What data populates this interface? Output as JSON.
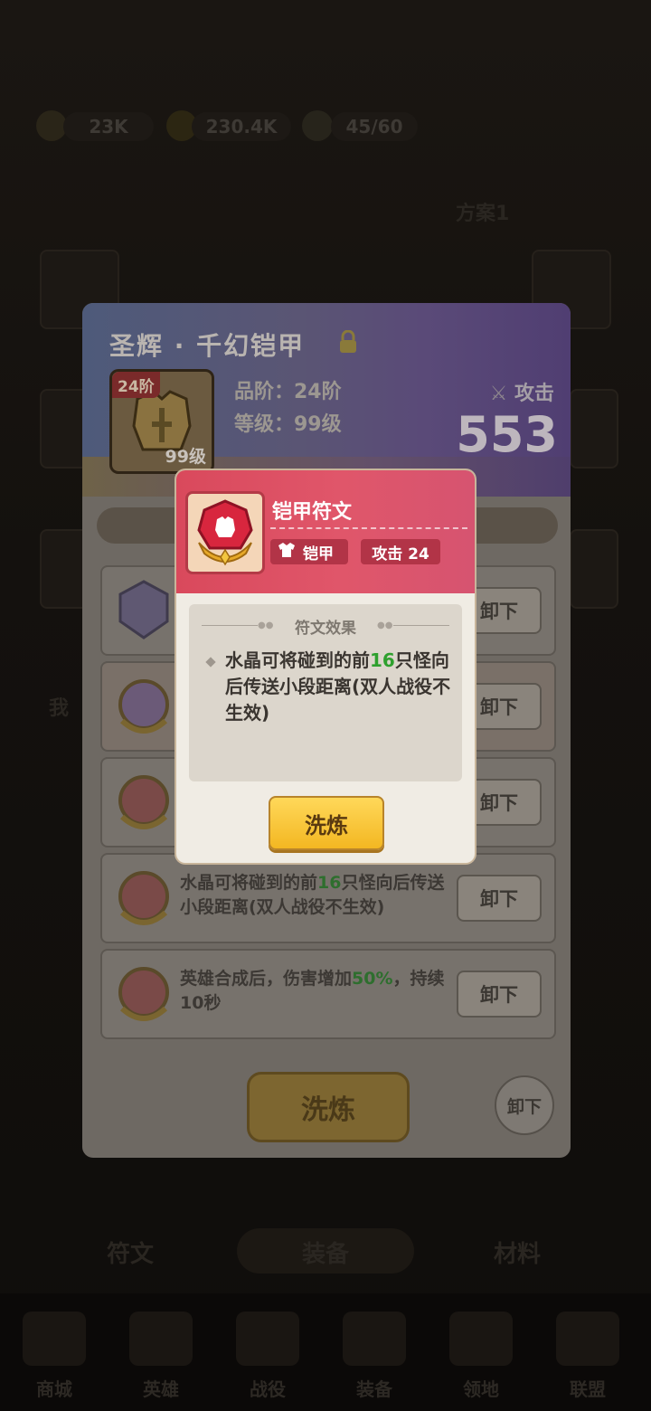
{
  "background": {
    "resources": [
      {
        "name": "gem",
        "value": "23K"
      },
      {
        "name": "gold",
        "value": "230.4K"
      },
      {
        "name": "stamina",
        "value": "45/60"
      }
    ],
    "scheme_label": "方案1",
    "side_label": "我",
    "bottom_tabs": [
      "符文",
      "装备",
      "材料"
    ],
    "nav": [
      "商城",
      "英雄",
      "战役",
      "装备",
      "领地",
      "联盟"
    ]
  },
  "equipment": {
    "title": "圣辉 · 千幻铠甲",
    "tier_badge": "24阶",
    "level_badge": "99级",
    "grade_line": "品阶：24阶",
    "level_line": "等级：99级",
    "attack_label": "攻击",
    "attack_value": "553",
    "rows": [
      {
        "text": "",
        "btn": "卸下"
      },
      {
        "text": "",
        "btn": "卸下"
      },
      {
        "text": "",
        "btn": "卸下"
      },
      {
        "text_a": "水晶可将碰到的前",
        "text_num": "16",
        "text_b": "只怪向后传送小段距离(双人战役不生效)",
        "btn": "卸下"
      },
      {
        "text_a": "英雄合成后，伤害增加",
        "text_num": "50%",
        "text_b": "，持续10秒",
        "btn": "卸下"
      }
    ],
    "wash_button": "洗炼",
    "unload_round": "卸下"
  },
  "dialog": {
    "title": "铠甲符文",
    "type_tag": "铠甲",
    "attack_tag": "攻击 24",
    "effect_header": "符文效果",
    "effect_a": "水晶可将碰到的前",
    "effect_num": "16",
    "effect_b": "只怪向后传送小段距离(双人战役不生效)",
    "wash_button": "洗炼"
  },
  "colors": {
    "dialog_header": "#dd4f63",
    "wash_button": "#f8c63a",
    "highlight_green": "#2ea02e"
  }
}
